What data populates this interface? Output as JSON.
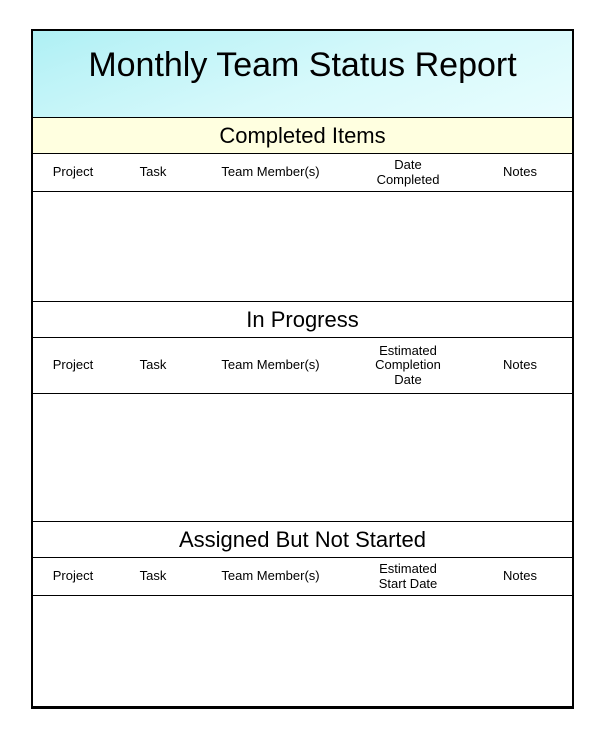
{
  "document": {
    "title": "Monthly Team Status Report",
    "title_band_color": "#b8f2f6",
    "frame_color": "#000000",
    "page_background": "#ffffff"
  },
  "sections": [
    {
      "id": "completed",
      "heading": "Completed Items",
      "heading_background": "#ffffe0",
      "columns": [
        {
          "key": "project",
          "label": "Project"
        },
        {
          "key": "task",
          "label": "Task"
        },
        {
          "key": "member",
          "label": "Team Member(s)"
        },
        {
          "key": "date",
          "label_line1": "Date",
          "label_line2": "Completed",
          "label_line3": ""
        },
        {
          "key": "notes",
          "label": "Notes"
        }
      ],
      "rows": []
    },
    {
      "id": "in-progress",
      "heading": "In Progress",
      "heading_background": "#ffffff",
      "columns": [
        {
          "key": "project",
          "label": "Project"
        },
        {
          "key": "task",
          "label": "Task"
        },
        {
          "key": "member",
          "label": "Team Member(s)"
        },
        {
          "key": "date",
          "label_line1": "Estimated",
          "label_line2": "Completion",
          "label_line3": "Date"
        },
        {
          "key": "notes",
          "label": "Notes"
        }
      ],
      "rows": []
    },
    {
      "id": "assigned-not-started",
      "heading": "Assigned But Not Started",
      "heading_background": "#ffffff",
      "columns": [
        {
          "key": "project",
          "label": "Project"
        },
        {
          "key": "task",
          "label": "Task"
        },
        {
          "key": "member",
          "label": "Team Member(s)"
        },
        {
          "key": "date",
          "label_line1": "Estimated",
          "label_line2": "Start Date",
          "label_line3": ""
        },
        {
          "key": "notes",
          "label": "Notes"
        }
      ],
      "rows": []
    }
  ]
}
